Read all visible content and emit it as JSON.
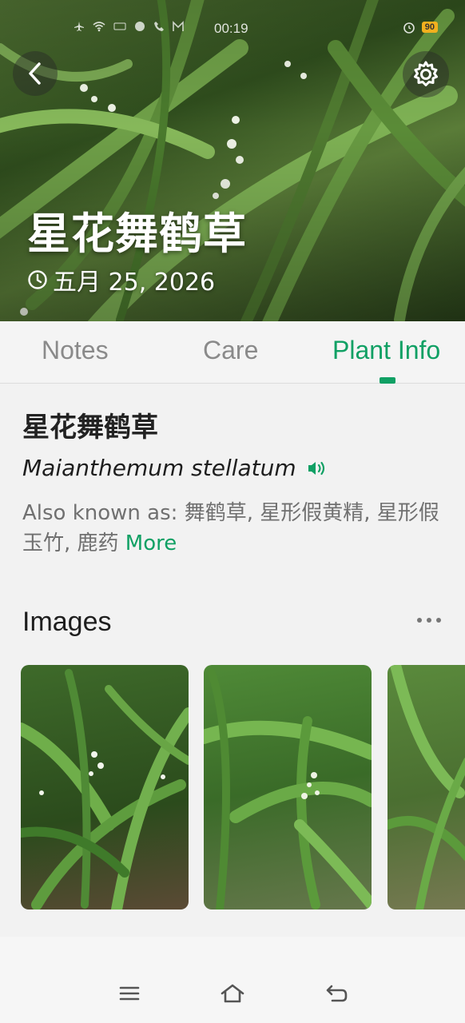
{
  "status_bar": {
    "time": "00:19",
    "battery": "90"
  },
  "hero": {
    "title": "星花舞鹤草",
    "date": "五月 25, 2026",
    "back_icon": "chevron-left-icon",
    "settings_icon": "gear-icon"
  },
  "tabs": [
    {
      "label": "Notes",
      "active": false
    },
    {
      "label": "Care",
      "active": false
    },
    {
      "label": "Plant Info",
      "active": true
    }
  ],
  "plant_info": {
    "name": "星花舞鹤草",
    "latin_name": "Maianthemum stellatum",
    "aka_prefix": "Also known as: ",
    "aka_values": "舞鹤草, 星形假黄精, 星形假玉竹, 鹿药",
    "more_label": "More"
  },
  "images_section": {
    "title": "Images",
    "count_visible": 3
  },
  "accent_color": "#10a064"
}
